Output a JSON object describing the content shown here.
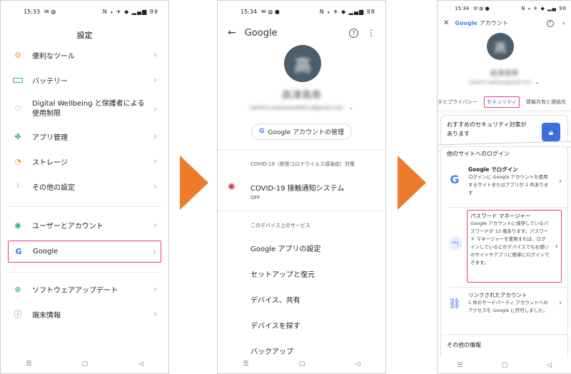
{
  "phone1": {
    "time": "15:33",
    "status_icons": "N ⁎ ✈ ◆ ▂▄▆ 99",
    "title": "設定",
    "items": [
      {
        "label": "便利なツール",
        "icon": "tools-icon",
        "color": "#f0a030"
      },
      {
        "label": "バッテリー",
        "icon": "battery-icon",
        "color": "#28b88a"
      },
      {
        "label": "Digital Wellbeing と保護者による使用制限",
        "icon": "wellbeing-icon",
        "color": "#28b060"
      },
      {
        "label": "アプリ管理",
        "icon": "apps-icon",
        "color": "#28b060"
      },
      {
        "label": "ストレージ",
        "icon": "storage-icon",
        "color": "#f0a030"
      },
      {
        "label": "その他の設定",
        "icon": "more-settings-icon",
        "color": "#3c6ee0"
      },
      {
        "label": "ユーザーとアカウント",
        "icon": "user-account-icon",
        "color": "#28b060"
      },
      {
        "label": "Google",
        "icon": "google-icon",
        "color": "#3c6ee0"
      },
      {
        "label": "ソフトウェアアップデート",
        "icon": "software-update-icon",
        "color": "#28b060"
      },
      {
        "label": "端末情報",
        "icon": "device-info-icon",
        "color": "#666666"
      }
    ]
  },
  "phone2": {
    "time": "15:34",
    "status_icons": "N ⁎ ✈ ◆ ▂▄▆ 98",
    "title": "Google",
    "avatar_char": "高",
    "name": "高津真希",
    "email": "takahiro.wakazukudekiru@gmail.com",
    "manage_button": "Google アカウントの管理",
    "covid_header": "COVID-19（新型コロナウイルス感染症）対策",
    "covid_title": "COVID-19 接触通知システム",
    "covid_sub": "OFF",
    "device_header": "このデバイス上のサービス",
    "services": [
      "Google アプリの設定",
      "セットアップと復元",
      "デバイス、共有",
      "デバイスを探す",
      "バックアップ"
    ]
  },
  "phone3": {
    "time": "15:34",
    "status_icons": "N ⁎ ✈ ◆ ▂▄ 98",
    "title_google": "Google",
    "title_account": "アカウント",
    "avatar_char": "高",
    "name": "高津真希",
    "email": "takahiro.wakazu@gmail.com",
    "tabs": [
      "タとプライバシー",
      "セキュリティ",
      "情報共有と連絡先"
    ],
    "rec_title": "おすすめのセキュリティ対策があります",
    "login_header": "他のサイトへのログイン",
    "entries": [
      {
        "title": "Google でログイン",
        "desc": "ログインに Google アカウントを使用するサイトまたはアプリが 2 件あります"
      },
      {
        "title": "パスワード マネージャー",
        "desc": "Google アカウントに保存しているパスワードが 12 個あります。パスワード マネージャーを使用すれば、ログインしているどのデバイスでもお使いのサイトやアプリに簡単にログインできます。"
      },
      {
        "title": "リンクされたアカウント",
        "desc": "1 件のサードパーティ アカウントへのアクセスを Google に許可しました。"
      }
    ],
    "other_header": "その他の情報"
  },
  "nav": {
    "menu": "☰",
    "home": "▢",
    "back": "◁"
  },
  "colors": {
    "highlight": "#e83a8c",
    "arrow": "#ee7a2b",
    "avatar": "#4d5d69"
  }
}
